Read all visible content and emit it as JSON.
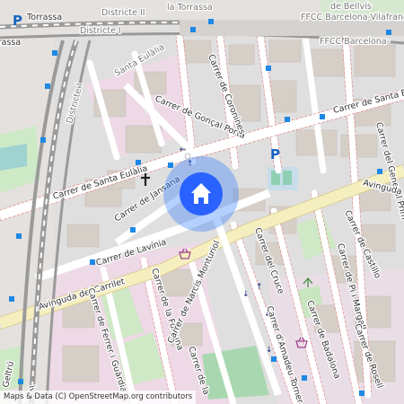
{
  "map": {
    "attribution": "Maps & Data (C) OpenStreetMap.org contributors",
    "colors": {
      "background": "#f2efe9",
      "residential": "#e0dfdf",
      "building": "#d9d0c9",
      "road": "#ffffff",
      "primary_road": "#fcf0c8",
      "railway": "#8a8a8a",
      "park": "#c8e6c0",
      "retail": "#ffd6d1",
      "marker_ring": "#2979ff",
      "marker_fill": "#2962ff",
      "transit_stop": "#1e88e5",
      "parking": "#1565c0"
    },
    "labels": {
      "torrassa_title": "Torrassa",
      "torrassa_left": "Torrassa",
      "district_ii": "Districte II",
      "la_torrassa": "la Torrassa",
      "bellvis": "de Bellvís",
      "ffcc_vilafranca": "FFCC Barcelona-Vilafranca",
      "ffcc_barcelona": "FFCC Barcelona-",
      "district_i_top": "Districte I",
      "district_i_side": "Districte I",
      "santa_eulalia_area": "Santa Eulàlia",
      "gonçal_porta": "Carrer de Gonçal Porta",
      "coronines": "Carrer de Coronines",
      "santa_eulalia_right": "Carrer de Santa Eulàl",
      "general_prim": "Carrer del General Prim",
      "santa_eulalia_left": "Carrer de Santa Eulàlia",
      "jansana": "Carrer de Jansana",
      "avinguda_right": "Avinguda de",
      "lavinia": "Carrer de Lavínia",
      "cruce": "Carrer del Cruce",
      "castillo": "Carrer de Castillo",
      "pi_margall": "Carrer de Pi i Margall",
      "carrilet": "Avinguda del Carrilet",
      "fortuna": "Carrer de la Fortuna",
      "ferrer_guardia": "Carrer de Ferrer i Guàrdia",
      "narcis_monturiol": "Carrer de Narcís Monturiol",
      "carrer_de_la": "Carrer de la",
      "amadeu_torner": "Carrer d'Amadeu Torner",
      "badalona": "Carrer de Badalona",
      "rosell": "Carrer de Rosell",
      "geltru": "Geltrú",
      "riva": "iva"
    },
    "icons": {
      "marker": "home-icon",
      "church": "cross-icon",
      "parking": "parking-icon",
      "shop": "basket-icon"
    }
  }
}
